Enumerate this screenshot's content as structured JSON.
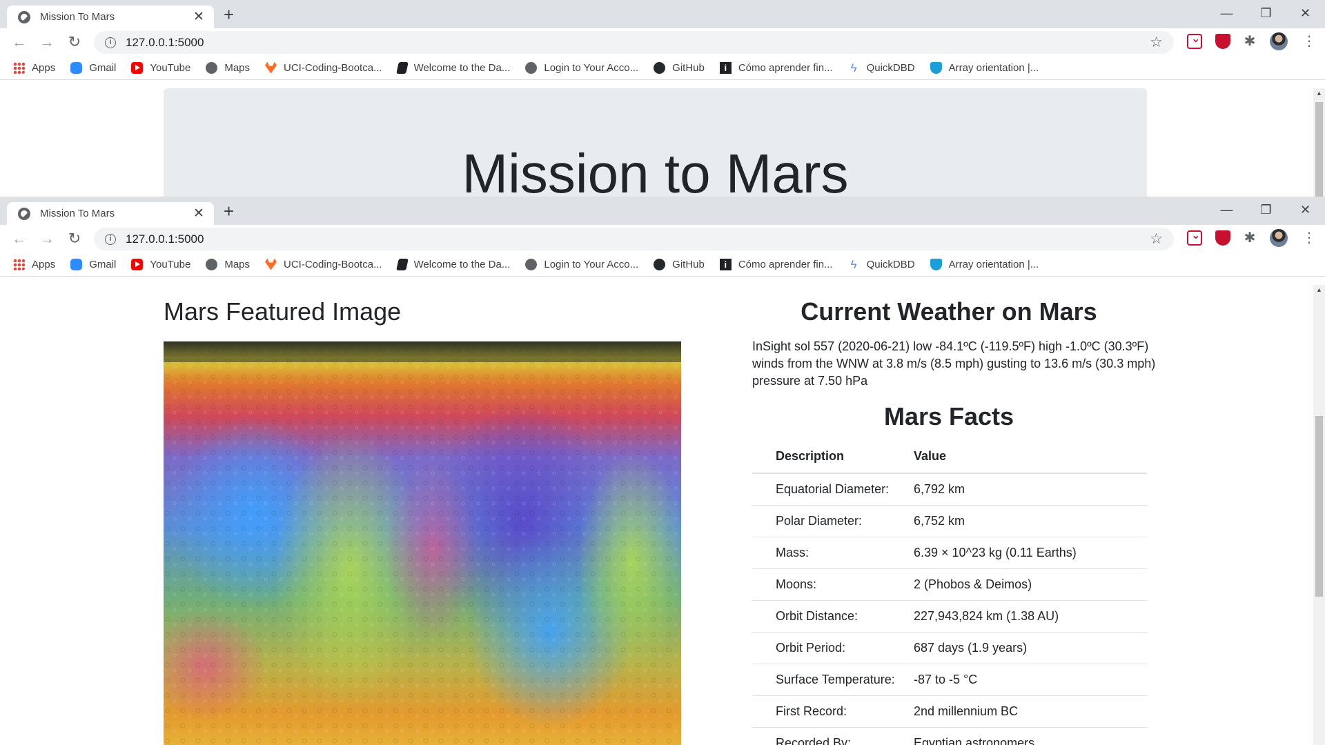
{
  "browser": {
    "tab_title": "Mission To Mars",
    "tab_close": "✕",
    "new_tab": "+",
    "url": "127.0.0.1:5000",
    "window_controls": [
      "—",
      "❐",
      "✕"
    ],
    "bookmarks": [
      {
        "label": "Apps",
        "icon": "apps-grid"
      },
      {
        "label": "Gmail",
        "icon": "zoom-camera"
      },
      {
        "label": "YouTube",
        "icon": "youtube"
      },
      {
        "label": "Maps",
        "icon": "globe"
      },
      {
        "label": "UCI-Coding-Bootca...",
        "icon": "gitlab-fox"
      },
      {
        "label": "Welcome to the Da...",
        "icon": "book"
      },
      {
        "label": "Login to Your Acco...",
        "icon": "globe"
      },
      {
        "label": "GitHub",
        "icon": "github"
      },
      {
        "label": "Cómo aprender fin...",
        "icon": "info"
      },
      {
        "label": "QuickDBD",
        "icon": "bolt"
      },
      {
        "label": "Array orientation |...",
        "icon": "shield"
      }
    ]
  },
  "page_top": {
    "heading": "Mission to Mars"
  },
  "page_bottom": {
    "featured_title": "Mars Featured Image",
    "weather_title": "Current Weather on Mars",
    "weather_text": "InSight sol 557 (2020-06-21) low -84.1ºC (-119.5ºF) high -1.0ºC (30.3ºF) winds from the WNW at 3.8 m/s (8.5 mph) gusting to 13.6 m/s (30.3 mph) pressure at 7.50 hPa",
    "facts_title": "Mars Facts",
    "facts_headers": [
      "Description",
      "Value"
    ],
    "facts_rows": [
      [
        "Equatorial Diameter:",
        "6,792 km"
      ],
      [
        "Polar Diameter:",
        "6,752 km"
      ],
      [
        "Mass:",
        "6.39 × 10^23 kg (0.11 Earths)"
      ],
      [
        "Moons:",
        "2 (Phobos & Deimos)"
      ],
      [
        "Orbit Distance:",
        "227,943,824 km (1.38 AU)"
      ],
      [
        "Orbit Period:",
        "687 days (1.9 years)"
      ],
      [
        "Surface Temperature:",
        "-87 to -5 °C"
      ],
      [
        "First Record:",
        "2nd millennium BC"
      ],
      [
        "Recorded By:",
        "Egyptian astronomers"
      ]
    ]
  }
}
